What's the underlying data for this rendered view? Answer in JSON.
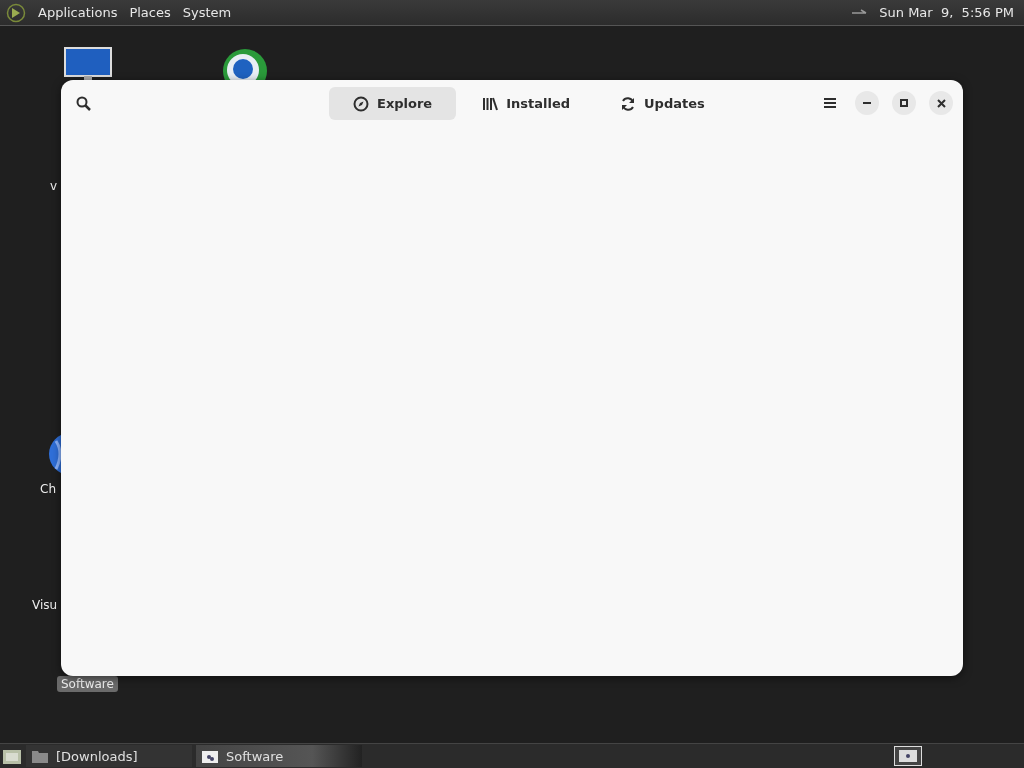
{
  "top_panel": {
    "menus": [
      "Applications",
      "Places",
      "System"
    ],
    "clock": "Sun Mar  9,  5:56 PM"
  },
  "desktop_icons": [
    {
      "label": "v",
      "selected": false
    },
    {
      "label": "Ch",
      "selected": false
    },
    {
      "label": "Visu",
      "selected": false
    },
    {
      "label": "Software",
      "selected": true
    }
  ],
  "window": {
    "tabs": [
      {
        "label": "Explore",
        "selected": true
      },
      {
        "label": "Installed",
        "selected": false
      },
      {
        "label": "Updates",
        "selected": false
      }
    ]
  },
  "taskbar": {
    "items": [
      {
        "label": "[Downloads]",
        "selected": false
      },
      {
        "label": "Software",
        "selected": true
      }
    ]
  }
}
